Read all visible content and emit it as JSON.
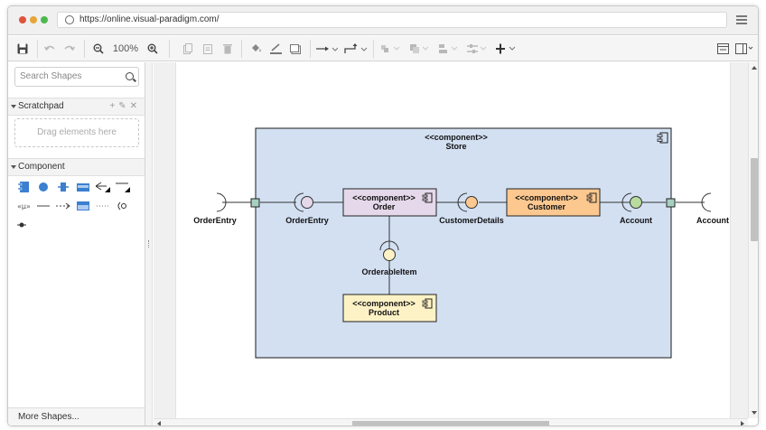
{
  "browser": {
    "url": "https://online.visual-paradigm.com/",
    "dots": [
      "#e0533d",
      "#e6a53a",
      "#4cb84c"
    ]
  },
  "toolbar": {
    "zoom_label": "100%",
    "icons": [
      "save-icon",
      "undo-icon",
      "redo-icon",
      "zoom-out-icon",
      "zoom-in-icon",
      "copy-icon",
      "paste-icon",
      "delete-icon",
      "fill-color-icon",
      "line-color-icon",
      "shadow-icon",
      "connector-icon",
      "waypoint-icon",
      "to-front-icon",
      "to-back-icon",
      "align-icon",
      "distribute-icon",
      "insert-icon",
      "format-panel-icon",
      "outline-panel-icon"
    ]
  },
  "sidebar": {
    "search_placeholder": "Search Shapes",
    "scratchpad_label": "Scratchpad",
    "dropzone_label": "Drag elements here",
    "component_label": "Component",
    "more_shapes_label": "More Shapes..."
  },
  "diagram": {
    "store_stereotype": "<<component>>",
    "store_name": "Store",
    "order_stereotype": "<<component>>",
    "order_name": "Order",
    "customer_stereotype": "<<component>>",
    "customer_name": "Customer",
    "product_stereotype": "<<component>>",
    "product_name": "Product",
    "labels": {
      "orderentry_outer": "OrderEntry",
      "orderentry_inner": "OrderEntry",
      "customerdetails": "CustomerDetails",
      "account_inner": "Account",
      "account_outer": "Account",
      "orderableitem": "OrderableItem"
    },
    "colors": {
      "store_fill": "#d3e0f2",
      "order_fill": "#e5d8ea",
      "customer_fill": "#fcc890",
      "product_fill": "#fdf2c6",
      "port_fill": "#a8d0c0",
      "ball_orderentry": "#e5d8ea",
      "ball_customerdetails": "#fcc890",
      "ball_account": "#b8dba0",
      "ball_orderableitem": "#fdf2c6"
    }
  }
}
